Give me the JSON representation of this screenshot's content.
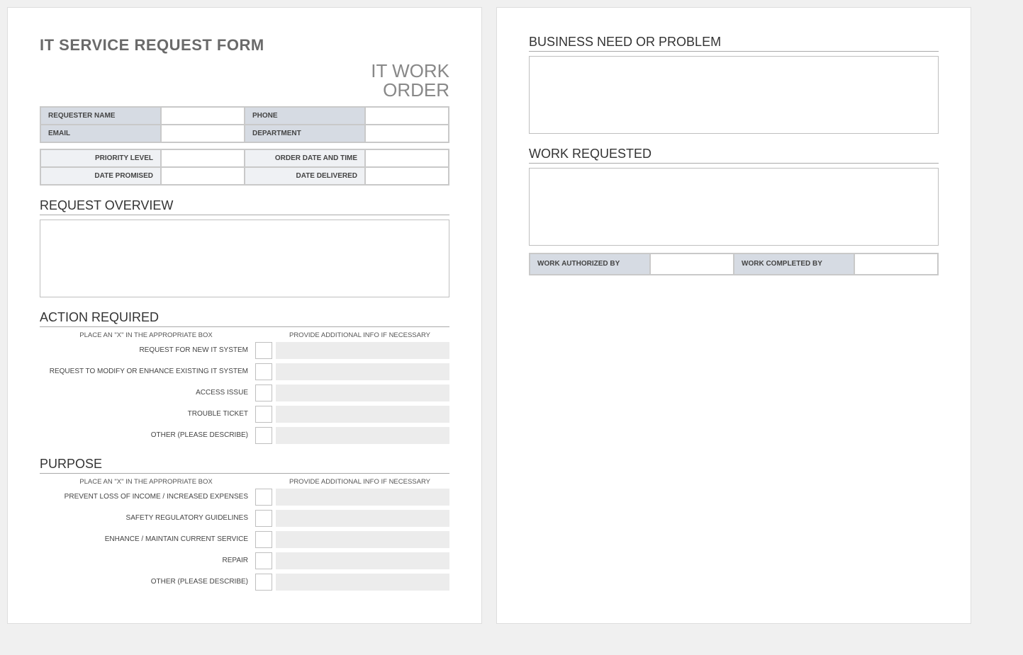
{
  "title": "IT SERVICE REQUEST FORM",
  "subtitle_line1": "IT WORK",
  "subtitle_line2": "ORDER",
  "requester": {
    "name_label": "REQUESTER NAME",
    "name_value": "",
    "phone_label": "PHONE",
    "phone_value": "",
    "email_label": "EMAIL",
    "email_value": "",
    "dept_label": "DEPARTMENT",
    "dept_value": ""
  },
  "meta": {
    "priority_label": "PRIORITY LEVEL",
    "priority_value": "",
    "order_date_label": "ORDER DATE AND TIME",
    "order_date_value": "",
    "date_promised_label": "DATE PROMISED",
    "date_promised_value": "",
    "date_delivered_label": "DATE DELIVERED",
    "date_delivered_value": ""
  },
  "sections": {
    "request_overview": "REQUEST OVERVIEW",
    "action_required": "ACTION REQUIRED",
    "purpose": "PURPOSE",
    "business_need": "BUSINESS NEED OR PROBLEM",
    "work_requested": "WORK REQUESTED"
  },
  "col_instructions": {
    "left": "PLACE AN \"X\" IN THE APPROPRIATE BOX",
    "right": "PROVIDE ADDITIONAL INFO IF NECESSARY"
  },
  "action_items": [
    {
      "label": "REQUEST FOR NEW IT SYSTEM",
      "checked": "",
      "info": ""
    },
    {
      "label": "REQUEST TO MODIFY OR ENHANCE EXISTING IT SYSTEM",
      "checked": "",
      "info": ""
    },
    {
      "label": "ACCESS ISSUE",
      "checked": "",
      "info": ""
    },
    {
      "label": "TROUBLE TICKET",
      "checked": "",
      "info": ""
    },
    {
      "label": "OTHER (PLEASE DESCRIBE)",
      "checked": "",
      "info": ""
    }
  ],
  "purpose_items": [
    {
      "label": "PREVENT LOSS OF INCOME / INCREASED EXPENSES",
      "checked": "",
      "info": ""
    },
    {
      "label": "SAFETY REGULATORY GUIDELINES",
      "checked": "",
      "info": ""
    },
    {
      "label": "ENHANCE / MAINTAIN CURRENT SERVICE",
      "checked": "",
      "info": ""
    },
    {
      "label": "REPAIR",
      "checked": "",
      "info": ""
    },
    {
      "label": "OTHER (PLEASE DESCRIBE)",
      "checked": "",
      "info": ""
    }
  ],
  "auth": {
    "authorized_label": "WORK AUTHORIZED BY",
    "authorized_value": "",
    "completed_label": "WORK COMPLETED BY",
    "completed_value": ""
  },
  "request_overview_value": "",
  "business_need_value": "",
  "work_requested_value": ""
}
